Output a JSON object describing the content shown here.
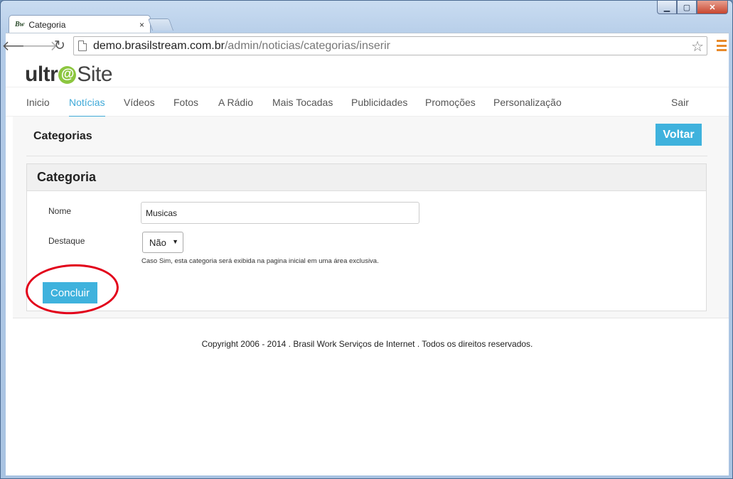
{
  "browser": {
    "tab_title": "Categoria",
    "tab_favicon": "Bw",
    "tab_close": "×",
    "url_host": "demo.brasilstream.com.br",
    "url_path": "/admin/noticias/categorias/inserir",
    "caption_minimize": "▁",
    "caption_maximize": "▢",
    "caption_close": "✕"
  },
  "logo": {
    "part1": "ultr",
    "at": "@",
    "part2": "Site"
  },
  "nav": {
    "items": [
      "Inicio",
      "Notícias",
      "Vídeos",
      "Fotos",
      "A Rádio",
      "Mais Tocadas",
      "Publicidades",
      "Promoções",
      "Personalização"
    ],
    "active_index": 1,
    "logout": "Sair"
  },
  "header": {
    "title": "Categorias",
    "back_label": "Voltar"
  },
  "form": {
    "panel_title": "Categoria",
    "name_label": "Nome",
    "name_value": "Musicas",
    "highlight_label": "Destaque",
    "highlight_value": "Não",
    "highlight_hint": "Caso Sim, esta categoria será exibida na pagina inicial em uma área exclusiva.",
    "submit_label": "Concluir"
  },
  "footer": {
    "text": "Copyright 2006 - 2014 . Brasil Work Serviços de Internet . Todos os direitos reservados."
  },
  "colors": {
    "accent": "#3fb2dd",
    "active_nav": "#3fa9d8",
    "logo_green": "#8cc63f",
    "annotation_circle": "#e2001a"
  }
}
